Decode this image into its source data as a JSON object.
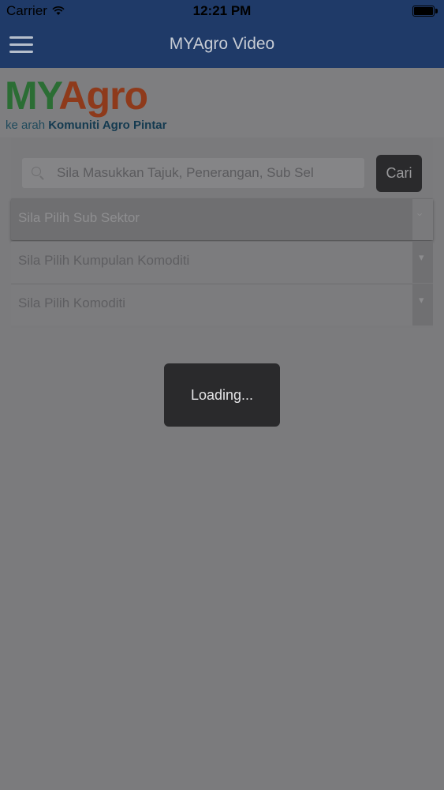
{
  "status_bar": {
    "carrier": "Carrier",
    "time": "12:21 PM"
  },
  "navbar": {
    "title": "MYAgro Video"
  },
  "logo": {
    "part1": "MY",
    "part2": "Agro",
    "tagline_prefix": "ke arah",
    "tagline_bold": "Komuniti Agro Pintar"
  },
  "search": {
    "placeholder": "Sila Masukkan Tajuk, Penerangan, Sub Sel",
    "value": "",
    "button_label": "Cari"
  },
  "dropdowns": [
    {
      "label": "Sila Pilih Sub Sektor"
    },
    {
      "label": "Sila Pilih Kumpulan Komoditi"
    },
    {
      "label": "Sila Pilih Komoditi"
    }
  ],
  "loading": {
    "text": "Loading..."
  },
  "colors": {
    "nav_bg": "#1f3a68",
    "logo_my": "#2b6d34",
    "logo_agro": "#8e3a1b",
    "overlay": "#7b7b7d"
  },
  "icons": [
    "wifi-icon",
    "battery-icon",
    "hamburger-menu-icon",
    "search-icon",
    "chevron-down-icon"
  ]
}
